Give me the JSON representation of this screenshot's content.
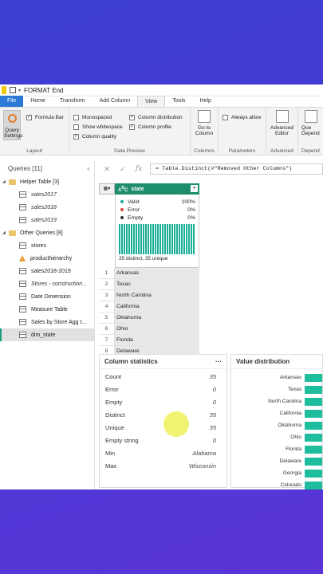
{
  "window": {
    "title": "FORMAT End"
  },
  "tabs": [
    "File",
    "Home",
    "Transform",
    "Add Column",
    "View",
    "Tools",
    "Help"
  ],
  "ribbon": {
    "query_settings": "Query Settings",
    "layout_label": "Layout",
    "formula_bar": "Formula Bar",
    "monospaced": "Monospaced",
    "show_whitespace": "Show whitespace",
    "column_quality": "Column quality",
    "column_distribution": "Column distribution",
    "column_profile": "Column profile",
    "data_preview_label": "Data Preview",
    "go_to_column": "Go to Column",
    "columns_label": "Columns",
    "always_allow": "Always allow",
    "parameters_label": "Parameters",
    "advanced_editor": "Advanced Editor",
    "advanced_label": "Advanced",
    "query_dep": "Que Depend",
    "depend_label": "Depend"
  },
  "queries": {
    "header": "Queries [11]",
    "helper_group": "Helper Table [3]",
    "helper_items": [
      "sales2017",
      "sales2018",
      "sales2019"
    ],
    "other_group": "Other Queries [8]",
    "other_items": [
      "stores",
      "producthierarchy",
      "sales2018-2019",
      "Stores - construction...",
      "Date Dimension",
      "Measure Table",
      "Sales by Store Agg t...",
      "dim_state"
    ]
  },
  "formula": {
    "text": "= Table.Distinct(#\"Removed Other Columns\")"
  },
  "column": {
    "name": "state",
    "valid_label": "Valid",
    "valid_pct": "100%",
    "error_label": "Error",
    "error_pct": "0%",
    "empty_label": "Empty",
    "empty_pct": "0%",
    "summary": "35 distinct, 35 unique",
    "rows": [
      "Arkansas",
      "Texas",
      "North Carolina",
      "California",
      "Oklahoma",
      "Ohio",
      "Florida",
      "Delaware"
    ]
  },
  "stats": {
    "title": "Column statistics",
    "rows": [
      {
        "label": "Count",
        "value": "35"
      },
      {
        "label": "Error",
        "value": "0"
      },
      {
        "label": "Empty",
        "value": "0"
      },
      {
        "label": "Distinct",
        "value": "35"
      },
      {
        "label": "Unique",
        "value": "35"
      },
      {
        "label": "Empty string",
        "value": "0"
      },
      {
        "label": "Min",
        "value": "Alabama"
      },
      {
        "label": "Max",
        "value": "Wisconsin"
      }
    ]
  },
  "value_distribution": {
    "title": "Value distribution",
    "items": [
      "Arkansas",
      "Texas",
      "North Carolina",
      "California",
      "Oklahoma",
      "Ohio",
      "Florida",
      "Delaware",
      "Georgia",
      "Colorado"
    ]
  },
  "colors": {
    "accent": "#1e8d6e",
    "file_tab": "#2b7bd6",
    "bar": "#1ebd9e"
  }
}
